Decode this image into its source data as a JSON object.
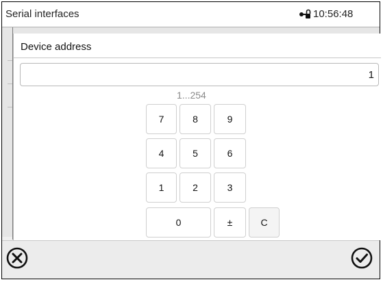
{
  "header": {
    "title": "Serial interfaces",
    "time": "10:56:48",
    "lock_icon": "lock-key-icon"
  },
  "dialog": {
    "title": "Device address",
    "value": "1",
    "range_hint": "1...254"
  },
  "keypad": {
    "rows": [
      [
        "7",
        "8",
        "9"
      ],
      [
        "4",
        "5",
        "6"
      ],
      [
        "1",
        "2",
        "3"
      ]
    ],
    "zero": "0",
    "plus_minus": "±",
    "clear": "C"
  },
  "footer": {
    "cancel_icon": "cancel-circle-x-icon",
    "confirm_icon": "confirm-circle-check-icon"
  },
  "colors": {
    "border": "#000000",
    "bar_bg": "#ececec",
    "hint_text": "#8a8a8a"
  }
}
